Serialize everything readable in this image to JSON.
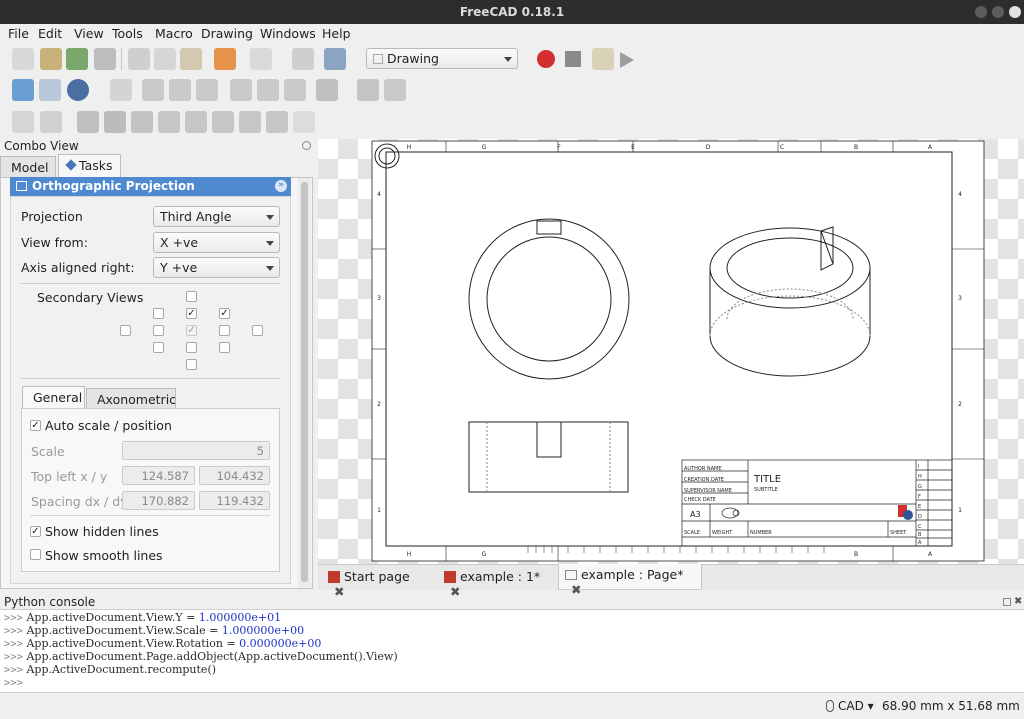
{
  "window": {
    "title": "FreeCAD 0.18.1"
  },
  "menu": [
    "File",
    "Edit",
    "View",
    "Tools",
    "Macro",
    "Drawing",
    "Windows",
    "Help"
  ],
  "toolbar": {
    "workbench": "Drawing"
  },
  "combo": {
    "title": "Combo View",
    "tabs": [
      "Model",
      "Tasks"
    ],
    "panel_title": "Orthographic Projection",
    "projection_label": "Projection",
    "projection_value": "Third Angle",
    "view_from_label": "View from:",
    "view_from_value": "X +ve",
    "axis_label": "Axis aligned right:",
    "axis_value": "Y +ve",
    "secondary_label": "Secondary Views",
    "subtabs": [
      "General",
      "Axonometric"
    ],
    "auto_scale": "Auto scale / position",
    "scale_label": "Scale",
    "scale_value": "5",
    "topleft_label": "Top left x / y",
    "topleft_x": "124.587",
    "topleft_y": "104.432",
    "spacing_label": "Spacing dx / dy",
    "spacing_x": "170.882",
    "spacing_y": "119.432",
    "show_hidden": "Show hidden lines",
    "show_smooth": "Show smooth lines"
  },
  "sheet": {
    "cols": [
      "H",
      "G",
      "F",
      "E",
      "D",
      "C",
      "B",
      "A"
    ],
    "rows": [
      "4",
      "3",
      "2",
      "1"
    ],
    "title_block": {
      "author": "AUTHOR NAME",
      "creation": "CREATION DATE",
      "supervisor": "SUPERVISOR NAME",
      "check": "CHECK DATE",
      "title": "TITLE",
      "subtitle": "SUBTITLE",
      "size": "A3",
      "scale": "SCALE",
      "weight": "WEIGHT",
      "number": "NUMBER",
      "sheet": "SHEET",
      "right_letters": [
        "I",
        "H",
        "G",
        "F",
        "E",
        "D",
        "C",
        "B",
        "A"
      ]
    }
  },
  "doc_tabs": [
    "Start page",
    "example : 1*",
    "example : Page*"
  ],
  "console": {
    "title": "Python console",
    "prompt": ">>>",
    "lines": [
      [
        "App.activeDocument",
        ".View.Y = ",
        "1.000000e+01"
      ],
      [
        "App.activeDocument",
        ".View.Scale = ",
        "1.000000e+00"
      ],
      [
        "App.activeDocument",
        ".View.Rotation = ",
        "0.000000e+00"
      ],
      [
        "App.activeDocument",
        ".Page.addObject(App.activeDocument().View)",
        ""
      ],
      [
        "App.ActiveDocument",
        ".recompute()",
        ""
      ]
    ]
  },
  "status": {
    "nav": "CAD",
    "dims": "68.90 mm x 51.68 mm"
  },
  "colors": {
    "accent": "#4a90d9",
    "panel_header": "#5a8fd0",
    "record": "#d32f2f"
  }
}
